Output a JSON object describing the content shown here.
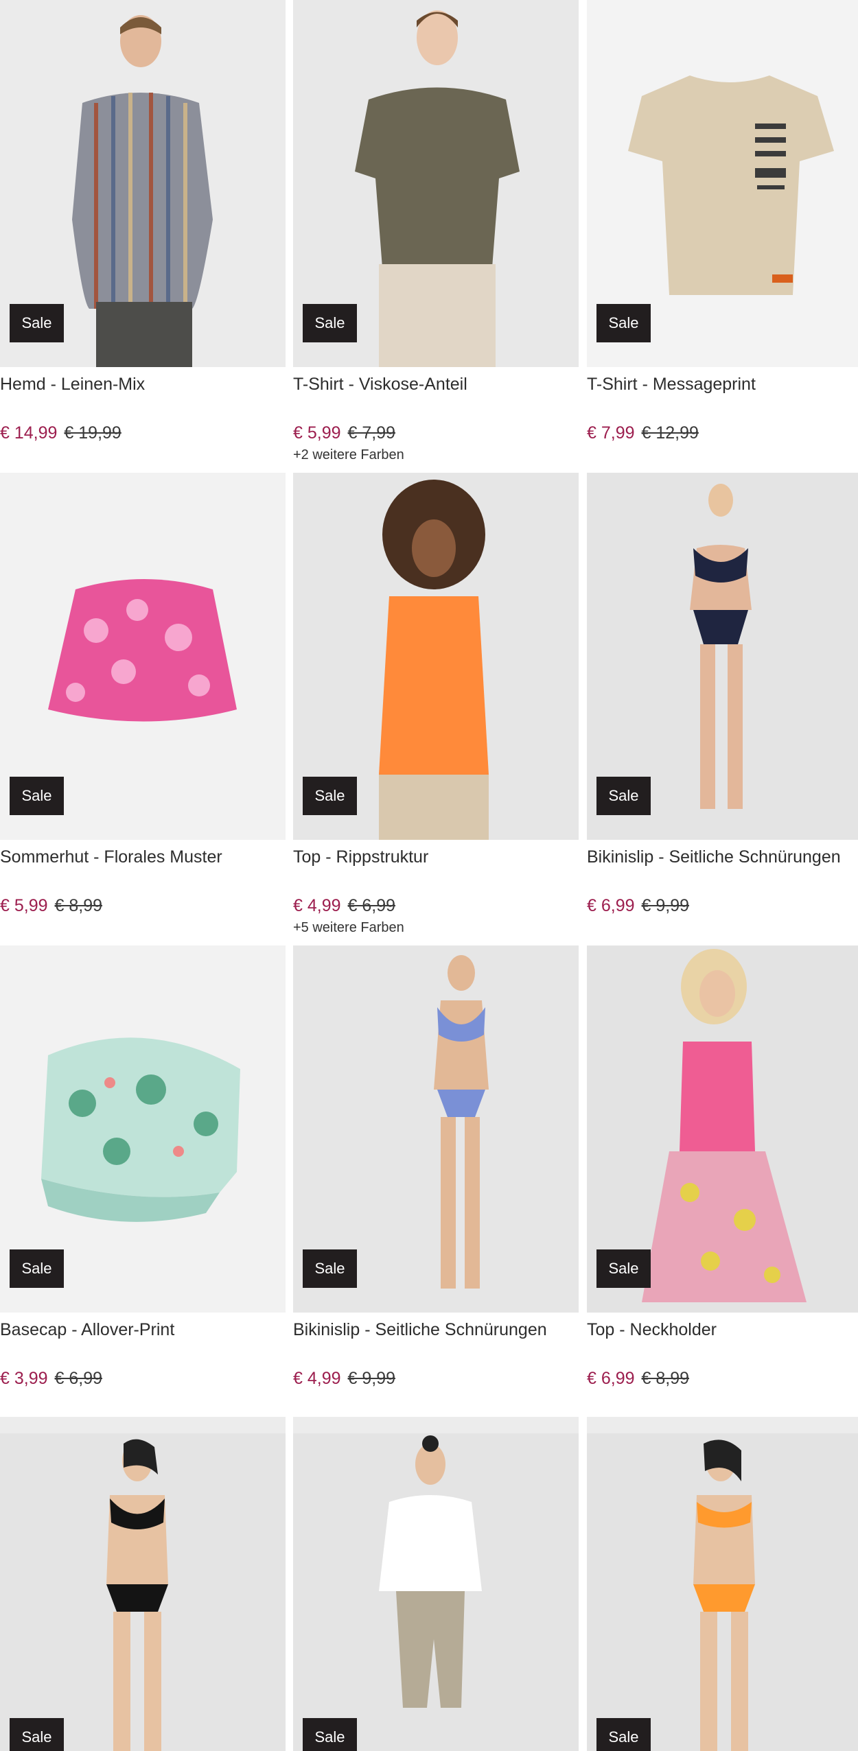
{
  "badge_label": "Sale",
  "colors": {
    "sale_price": "#9c1e4e",
    "badge_bg": "#221e1f",
    "text": "#2d2d2d"
  },
  "products": [
    {
      "title": "Hemd - Leinen-Mix",
      "price": "€ 14,99",
      "old_price": "€ 19,99",
      "more_colors": ""
    },
    {
      "title": "T-Shirt - Viskose-Anteil",
      "price": "€ 5,99",
      "old_price": "€ 7,99",
      "more_colors": "+2 weitere Farben"
    },
    {
      "title": "T-Shirt - Messageprint",
      "price": "€ 7,99",
      "old_price": "€ 12,99",
      "more_colors": ""
    },
    {
      "title": "Sommerhut - Florales Muster",
      "price": "€ 5,99",
      "old_price": "€ 8,99",
      "more_colors": ""
    },
    {
      "title": "Top - Rippstruktur",
      "price": "€ 4,99",
      "old_price": "€ 6,99",
      "more_colors": "+5 weitere Farben"
    },
    {
      "title": "Bikinislip - Seitliche Schnürungen",
      "price": "€ 6,99",
      "old_price": "€ 9,99",
      "more_colors": ""
    },
    {
      "title": "Basecap - Allover-Print",
      "price": "€ 3,99",
      "old_price": "€ 6,99",
      "more_colors": ""
    },
    {
      "title": "Bikinislip - Seitliche Schnürungen",
      "price": "€ 4,99",
      "old_price": "€ 9,99",
      "more_colors": ""
    },
    {
      "title": "Top - Neckholder",
      "price": "€ 6,99",
      "old_price": "€ 8,99",
      "more_colors": ""
    },
    {
      "title": "",
      "price": "",
      "old_price": "",
      "more_colors": ""
    },
    {
      "title": "",
      "price": "",
      "old_price": "",
      "more_colors": ""
    },
    {
      "title": "",
      "price": "",
      "old_price": "",
      "more_colors": ""
    }
  ]
}
